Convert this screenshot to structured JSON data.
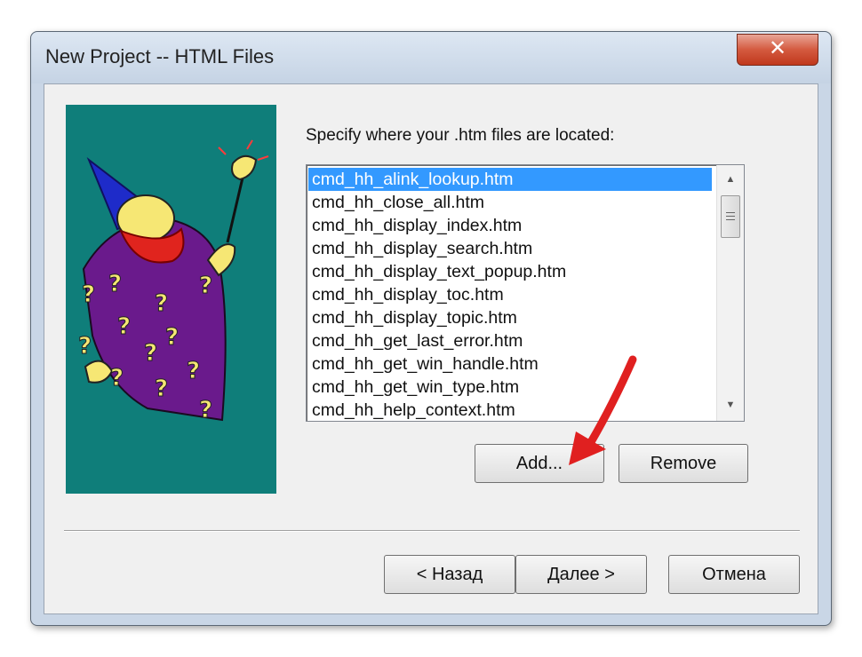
{
  "window": {
    "title": "New Project -- HTML Files",
    "close_label": "✕"
  },
  "prompt": "Specify where your .htm files are located:",
  "files": [
    "cmd_hh_alink_lookup.htm",
    "cmd_hh_close_all.htm",
    "cmd_hh_display_index.htm",
    "cmd_hh_display_search.htm",
    "cmd_hh_display_text_popup.htm",
    "cmd_hh_display_toc.htm",
    "cmd_hh_display_topic.htm",
    "cmd_hh_get_last_error.htm",
    "cmd_hh_get_win_handle.htm",
    "cmd_hh_get_win_type.htm",
    "cmd_hh_help_context.htm"
  ],
  "selected_index": 0,
  "buttons": {
    "add": "Add...",
    "remove": "Remove",
    "back": "< Назад",
    "next": "Далее >",
    "cancel": "Отмена"
  },
  "icons": {
    "scroll_up": "scroll-up-arrow-icon",
    "scroll_down": "scroll-down-arrow-icon",
    "wizard": "wizard-illustration",
    "annotation": "red-arrow-annotation"
  },
  "colors": {
    "selection": "#3399ff",
    "wizard_background": "#0f7e7a",
    "close_button": "#d45a3f",
    "annotation_arrow": "#e02020"
  }
}
